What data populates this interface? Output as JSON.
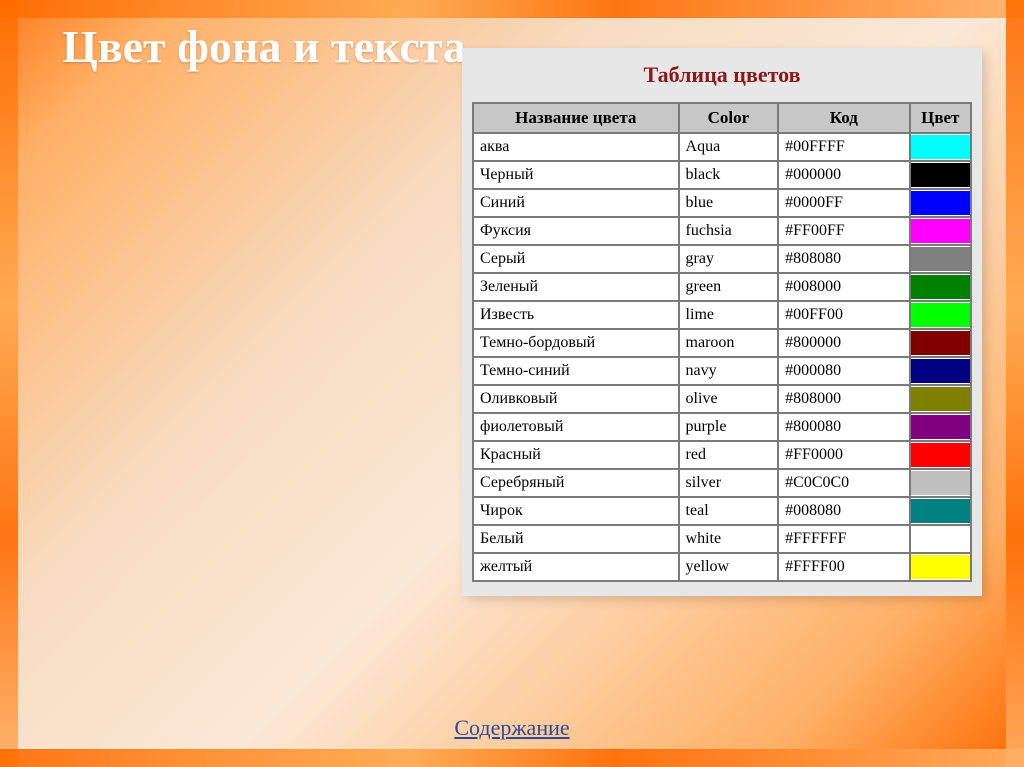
{
  "title": "Цвет фона и текста",
  "panel_title": "Таблица цветов",
  "toc_link": "Содержание",
  "table": {
    "headers": {
      "ru_name": "Название цвета",
      "color": "Color",
      "code": "Код",
      "sample": "Цвет"
    },
    "rows": [
      {
        "ru": "аква",
        "en": "Aqua",
        "code": "#00FFFF",
        "hex": "#00FFFF"
      },
      {
        "ru": "Черный",
        "en": "black",
        "code": "#000000",
        "hex": "#000000"
      },
      {
        "ru": "Синий",
        "en": "blue",
        "code": "#0000FF",
        "hex": "#0000FF"
      },
      {
        "ru": "Фуксия",
        "en": "fuchsia",
        "code": "#FF00FF",
        "hex": "#FF00FF"
      },
      {
        "ru": "Серый",
        "en": "gray",
        "code": "#808080",
        "hex": "#808080"
      },
      {
        "ru": "Зеленый",
        "en": "green",
        "code": "#008000",
        "hex": "#008000"
      },
      {
        "ru": "Известь",
        "en": "lime",
        "code": "#00FF00",
        "hex": "#00FF00"
      },
      {
        "ru": "Темно-бордовый",
        "en": "maroon",
        "code": "#800000",
        "hex": "#800000"
      },
      {
        "ru": "Темно-синий",
        "en": "navy",
        "code": "#000080",
        "hex": "#000080"
      },
      {
        "ru": "Оливковый",
        "en": "olive",
        "code": "#808000",
        "hex": "#808000"
      },
      {
        "ru": "фиолетовый",
        "en": "purple",
        "code": "#800080",
        "hex": "#800080"
      },
      {
        "ru": "Красный",
        "en": "red",
        "code": "#FF0000",
        "hex": "#FF0000"
      },
      {
        "ru": "Серебряный",
        "en": "silver",
        "code": "#C0C0C0",
        "hex": "#C0C0C0"
      },
      {
        "ru": "Чирок",
        "en": "teal",
        "code": "#008080",
        "hex": "#008080"
      },
      {
        "ru": "Белый",
        "en": "white",
        "code": "#FFFFFF",
        "hex": "#FFFFFF"
      },
      {
        "ru": "желтый",
        "en": "yellow",
        "code": "#FFFF00",
        "hex": "#FFFF00"
      }
    ]
  }
}
